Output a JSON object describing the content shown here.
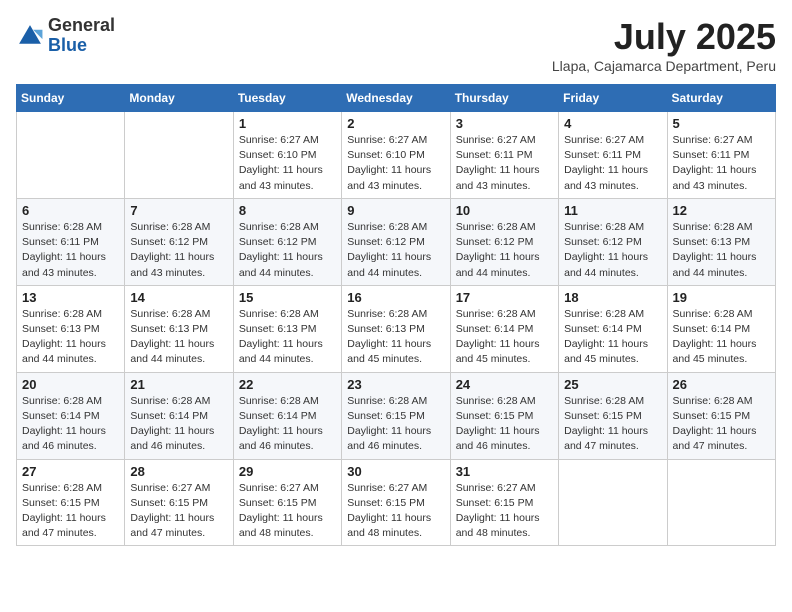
{
  "header": {
    "logo_general": "General",
    "logo_blue": "Blue",
    "month_year": "July 2025",
    "location": "Llapa, Cajamarca Department, Peru"
  },
  "days_of_week": [
    "Sunday",
    "Monday",
    "Tuesday",
    "Wednesday",
    "Thursday",
    "Friday",
    "Saturday"
  ],
  "weeks": [
    [
      {
        "day": "",
        "info": ""
      },
      {
        "day": "",
        "info": ""
      },
      {
        "day": "1",
        "info": "Sunrise: 6:27 AM\nSunset: 6:10 PM\nDaylight: 11 hours and 43 minutes."
      },
      {
        "day": "2",
        "info": "Sunrise: 6:27 AM\nSunset: 6:10 PM\nDaylight: 11 hours and 43 minutes."
      },
      {
        "day": "3",
        "info": "Sunrise: 6:27 AM\nSunset: 6:11 PM\nDaylight: 11 hours and 43 minutes."
      },
      {
        "day": "4",
        "info": "Sunrise: 6:27 AM\nSunset: 6:11 PM\nDaylight: 11 hours and 43 minutes."
      },
      {
        "day": "5",
        "info": "Sunrise: 6:27 AM\nSunset: 6:11 PM\nDaylight: 11 hours and 43 minutes."
      }
    ],
    [
      {
        "day": "6",
        "info": "Sunrise: 6:28 AM\nSunset: 6:11 PM\nDaylight: 11 hours and 43 minutes."
      },
      {
        "day": "7",
        "info": "Sunrise: 6:28 AM\nSunset: 6:12 PM\nDaylight: 11 hours and 43 minutes."
      },
      {
        "day": "8",
        "info": "Sunrise: 6:28 AM\nSunset: 6:12 PM\nDaylight: 11 hours and 44 minutes."
      },
      {
        "day": "9",
        "info": "Sunrise: 6:28 AM\nSunset: 6:12 PM\nDaylight: 11 hours and 44 minutes."
      },
      {
        "day": "10",
        "info": "Sunrise: 6:28 AM\nSunset: 6:12 PM\nDaylight: 11 hours and 44 minutes."
      },
      {
        "day": "11",
        "info": "Sunrise: 6:28 AM\nSunset: 6:12 PM\nDaylight: 11 hours and 44 minutes."
      },
      {
        "day": "12",
        "info": "Sunrise: 6:28 AM\nSunset: 6:13 PM\nDaylight: 11 hours and 44 minutes."
      }
    ],
    [
      {
        "day": "13",
        "info": "Sunrise: 6:28 AM\nSunset: 6:13 PM\nDaylight: 11 hours and 44 minutes."
      },
      {
        "day": "14",
        "info": "Sunrise: 6:28 AM\nSunset: 6:13 PM\nDaylight: 11 hours and 44 minutes."
      },
      {
        "day": "15",
        "info": "Sunrise: 6:28 AM\nSunset: 6:13 PM\nDaylight: 11 hours and 44 minutes."
      },
      {
        "day": "16",
        "info": "Sunrise: 6:28 AM\nSunset: 6:13 PM\nDaylight: 11 hours and 45 minutes."
      },
      {
        "day": "17",
        "info": "Sunrise: 6:28 AM\nSunset: 6:14 PM\nDaylight: 11 hours and 45 minutes."
      },
      {
        "day": "18",
        "info": "Sunrise: 6:28 AM\nSunset: 6:14 PM\nDaylight: 11 hours and 45 minutes."
      },
      {
        "day": "19",
        "info": "Sunrise: 6:28 AM\nSunset: 6:14 PM\nDaylight: 11 hours and 45 minutes."
      }
    ],
    [
      {
        "day": "20",
        "info": "Sunrise: 6:28 AM\nSunset: 6:14 PM\nDaylight: 11 hours and 46 minutes."
      },
      {
        "day": "21",
        "info": "Sunrise: 6:28 AM\nSunset: 6:14 PM\nDaylight: 11 hours and 46 minutes."
      },
      {
        "day": "22",
        "info": "Sunrise: 6:28 AM\nSunset: 6:14 PM\nDaylight: 11 hours and 46 minutes."
      },
      {
        "day": "23",
        "info": "Sunrise: 6:28 AM\nSunset: 6:15 PM\nDaylight: 11 hours and 46 minutes."
      },
      {
        "day": "24",
        "info": "Sunrise: 6:28 AM\nSunset: 6:15 PM\nDaylight: 11 hours and 46 minutes."
      },
      {
        "day": "25",
        "info": "Sunrise: 6:28 AM\nSunset: 6:15 PM\nDaylight: 11 hours and 47 minutes."
      },
      {
        "day": "26",
        "info": "Sunrise: 6:28 AM\nSunset: 6:15 PM\nDaylight: 11 hours and 47 minutes."
      }
    ],
    [
      {
        "day": "27",
        "info": "Sunrise: 6:28 AM\nSunset: 6:15 PM\nDaylight: 11 hours and 47 minutes."
      },
      {
        "day": "28",
        "info": "Sunrise: 6:27 AM\nSunset: 6:15 PM\nDaylight: 11 hours and 47 minutes."
      },
      {
        "day": "29",
        "info": "Sunrise: 6:27 AM\nSunset: 6:15 PM\nDaylight: 11 hours and 48 minutes."
      },
      {
        "day": "30",
        "info": "Sunrise: 6:27 AM\nSunset: 6:15 PM\nDaylight: 11 hours and 48 minutes."
      },
      {
        "day": "31",
        "info": "Sunrise: 6:27 AM\nSunset: 6:15 PM\nDaylight: 11 hours and 48 minutes."
      },
      {
        "day": "",
        "info": ""
      },
      {
        "day": "",
        "info": ""
      }
    ]
  ]
}
